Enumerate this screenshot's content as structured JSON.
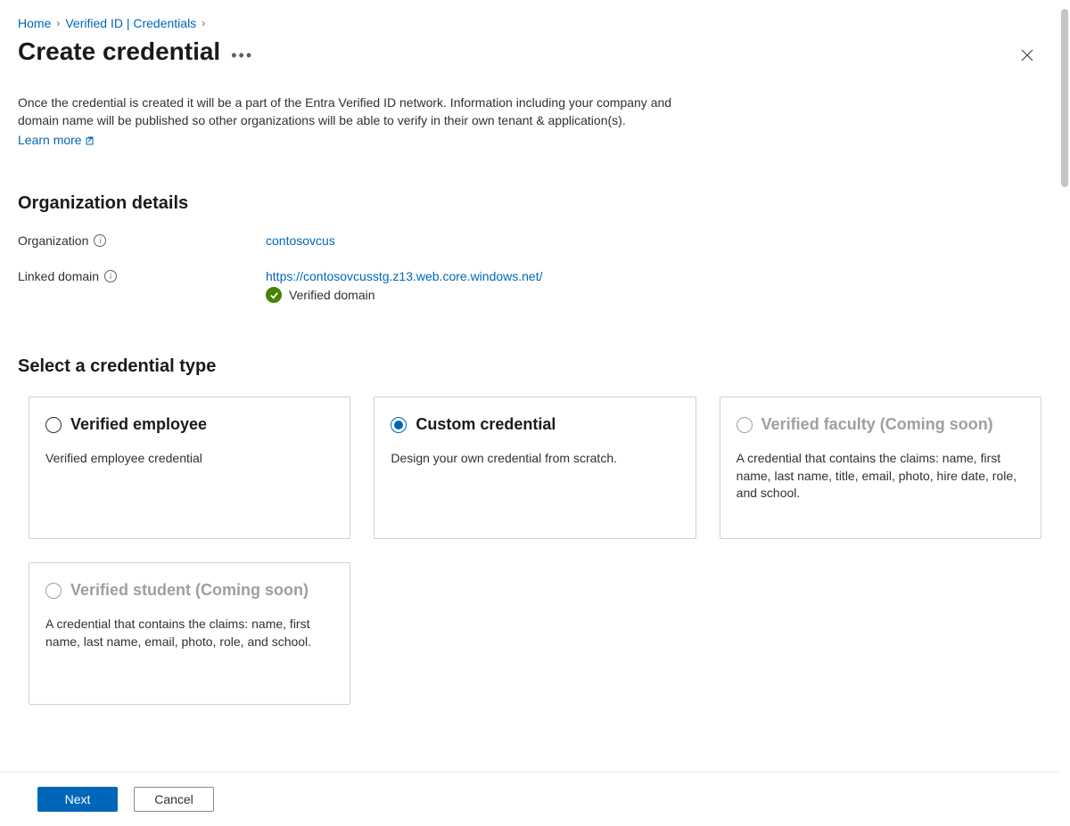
{
  "breadcrumb": {
    "home": "Home",
    "vid": "Verified ID | Credentials"
  },
  "page": {
    "title": "Create credential",
    "description": "Once the credential is created it will be a part of the Entra Verified ID network. Information including your company and domain name will be published so other organizations will be able to verify in their own tenant & application(s).",
    "learn_more": "Learn more"
  },
  "org_section": {
    "heading": "Organization details",
    "org_label": "Organization",
    "org_value": "contosovcus",
    "domain_label": "Linked domain",
    "domain_value": "https://contosovcusstg.z13.web.core.windows.net/",
    "verified_text": "Verified domain"
  },
  "cred_section": {
    "heading": "Select a credential type",
    "cards": [
      {
        "title": "Verified employee",
        "desc": "Verified employee credential"
      },
      {
        "title": "Custom credential",
        "desc": "Design your own credential from scratch."
      },
      {
        "title": "Verified faculty (Coming soon)",
        "desc": "A credential that contains the claims: name, first name, last name, title, email, photo, hire date, role, and school."
      },
      {
        "title": "Verified student (Coming soon)",
        "desc": "A credential that contains the claims: name, first name, last name, email, photo, role, and school."
      }
    ]
  },
  "footer": {
    "next": "Next",
    "cancel": "Cancel"
  }
}
